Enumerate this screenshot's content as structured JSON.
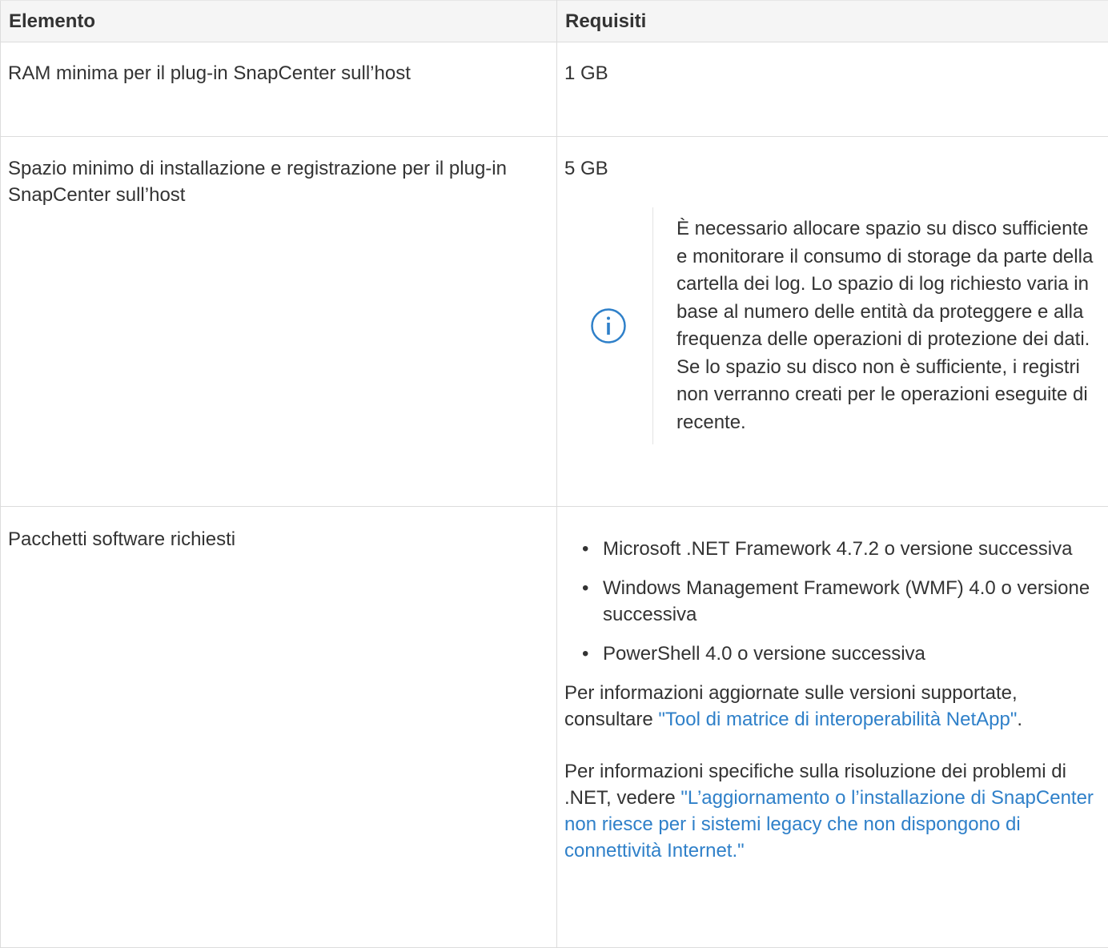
{
  "table": {
    "headers": [
      "Elemento",
      "Requisiti"
    ],
    "rows": [
      {
        "item": "RAM minima per il plug-in SnapCenter sull’host",
        "value": "1 GB"
      },
      {
        "item": "Spazio minimo di installazione e registrazione per il plug-in SnapCenter sull’host",
        "value": "5 GB",
        "note": {
          "icon": "info-circle-icon",
          "text": "È necessario allocare spazio su disco sufficiente e monitorare il consumo di storage da parte della cartella dei log. Lo spazio di log richiesto varia in base al numero delle entità da proteggere e alla frequenza delle operazioni di protezione dei dati. Se lo spazio su disco non è sufficiente, i registri non verranno creati per le operazioni eseguite di recente."
        }
      },
      {
        "item": "Pacchetti software richiesti",
        "packages": [
          "Microsoft .NET Framework 4.7.2 o versione successiva",
          "Windows Management Framework (WMF) 4.0 o versione successiva",
          "PowerShell 4.0 o versione successiva"
        ],
        "para1": {
          "before": "Per informazioni aggiornate sulle versioni supportate, consultare ",
          "link": "\"Tool di matrice di interoperabilità NetApp\"",
          "after": "."
        },
        "para2": {
          "before": "Per informazioni specifiche sulla risoluzione dei problemi di .NET, vedere ",
          "link": "\"L’aggiornamento o l’installazione di SnapCenter non riesce per i sistemi legacy che non dispongono di connettività Internet.\""
        }
      }
    ]
  },
  "colors": {
    "header_bg": "#f5f5f5",
    "link": "#2f80c9",
    "info_icon": "#2f80c9",
    "text": "#333333",
    "border": "#dcdcdc"
  }
}
